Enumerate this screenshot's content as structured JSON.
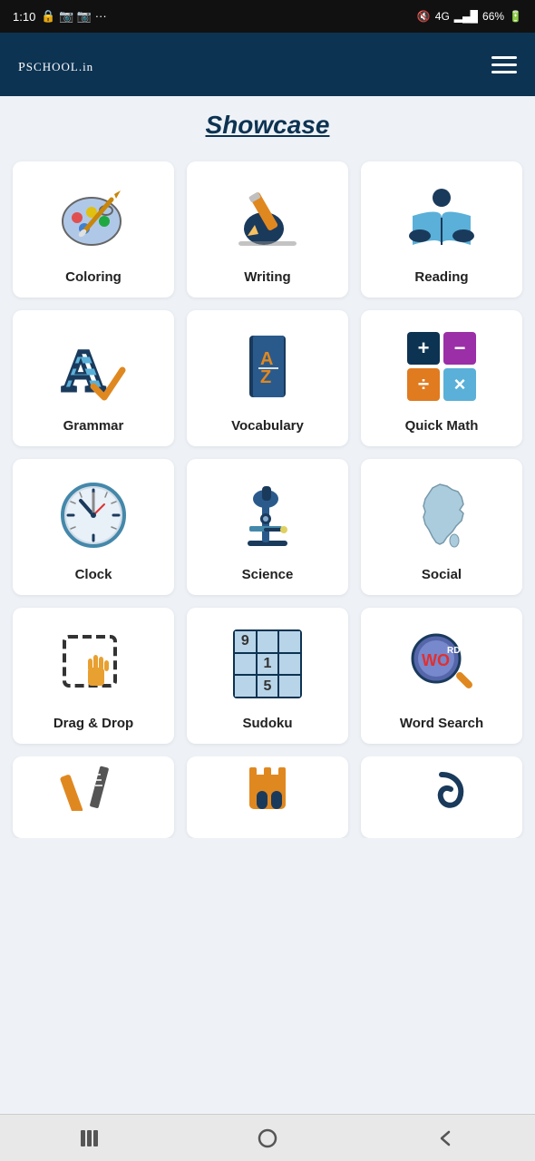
{
  "statusBar": {
    "time": "1:10",
    "battery": "66%",
    "signal": "4G"
  },
  "header": {
    "logo": "PSchool",
    "logoDomain": ".in",
    "menuAriaLabel": "Menu"
  },
  "showcase": {
    "title": "Showcase"
  },
  "items": [
    {
      "id": "coloring",
      "label": "Coloring"
    },
    {
      "id": "writing",
      "label": "Writing"
    },
    {
      "id": "reading",
      "label": "Reading"
    },
    {
      "id": "grammar",
      "label": "Grammar"
    },
    {
      "id": "vocabulary",
      "label": "Vocabulary"
    },
    {
      "id": "quickmath",
      "label": "Quick Math"
    },
    {
      "id": "clock",
      "label": "Clock"
    },
    {
      "id": "science",
      "label": "Science"
    },
    {
      "id": "social",
      "label": "Social"
    },
    {
      "id": "dragdrop",
      "label": "Drag & Drop"
    },
    {
      "id": "sudoku",
      "label": "Sudoku"
    },
    {
      "id": "wordsearch",
      "label": "Word Search"
    }
  ],
  "nav": {
    "back": "‹",
    "home": "○",
    "recent": "|||"
  }
}
